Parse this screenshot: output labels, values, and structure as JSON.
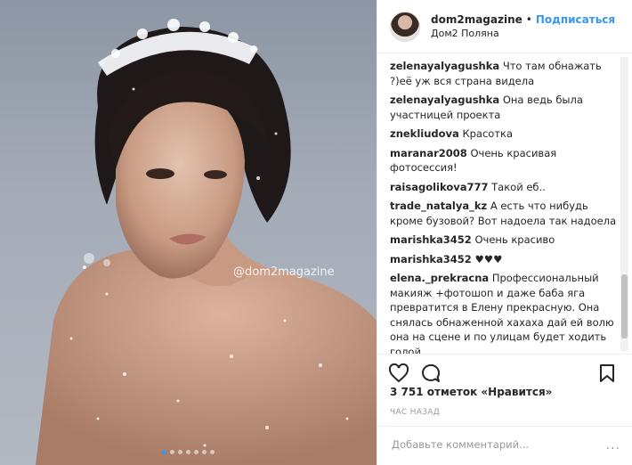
{
  "post": {
    "watermark": "@dom2magazine",
    "photo_dots": 7,
    "active_dot": 0
  },
  "header": {
    "username": "dom2magazine",
    "separator": "•",
    "follow_label": "Подписаться",
    "location": "Дом2 Поляна"
  },
  "comments": [
    {
      "user": "zelenayalyagushka",
      "text": "Что там обнажать ?)её уж вся страна видела"
    },
    {
      "user": "zelenayalyagushka",
      "text": "Она ведь была участницей проекта"
    },
    {
      "user": "znekliudova",
      "text": "Красотка"
    },
    {
      "user": "maranar2008",
      "text": "Очень красивая фотосессия!"
    },
    {
      "user": "raisagolikova777",
      "text": "Такой еб.."
    },
    {
      "user": "trade_natalya_kz",
      "text": "А есть что нибудь кроме бузовой? Вот надоела так надоела"
    },
    {
      "user": "marishka3452",
      "text": "Очень красиво"
    },
    {
      "user": "marishka3452",
      "text": "♥♥♥"
    },
    {
      "user": "elena._prekracna",
      "text": "Профессиональный макияж +фотошоп и даже баба яга превратится в Елену прекрасную. Она снялась обнаженной хахаха дай ей волю она на сцене и по улицам будет ходить голой."
    }
  ],
  "actions": {
    "like_icon": "heart-icon",
    "comment_icon": "comment-icon",
    "save_icon": "bookmark-icon"
  },
  "likes_text": "3 751 отметок «Нравится»",
  "time_text": "ЧАС НАЗАД",
  "add_comment": {
    "placeholder": "Добавьте комментарий...",
    "more": "..."
  },
  "colors": {
    "link_blue": "#3897f0",
    "text": "#262626",
    "muted": "#999999",
    "border": "#efefef"
  }
}
